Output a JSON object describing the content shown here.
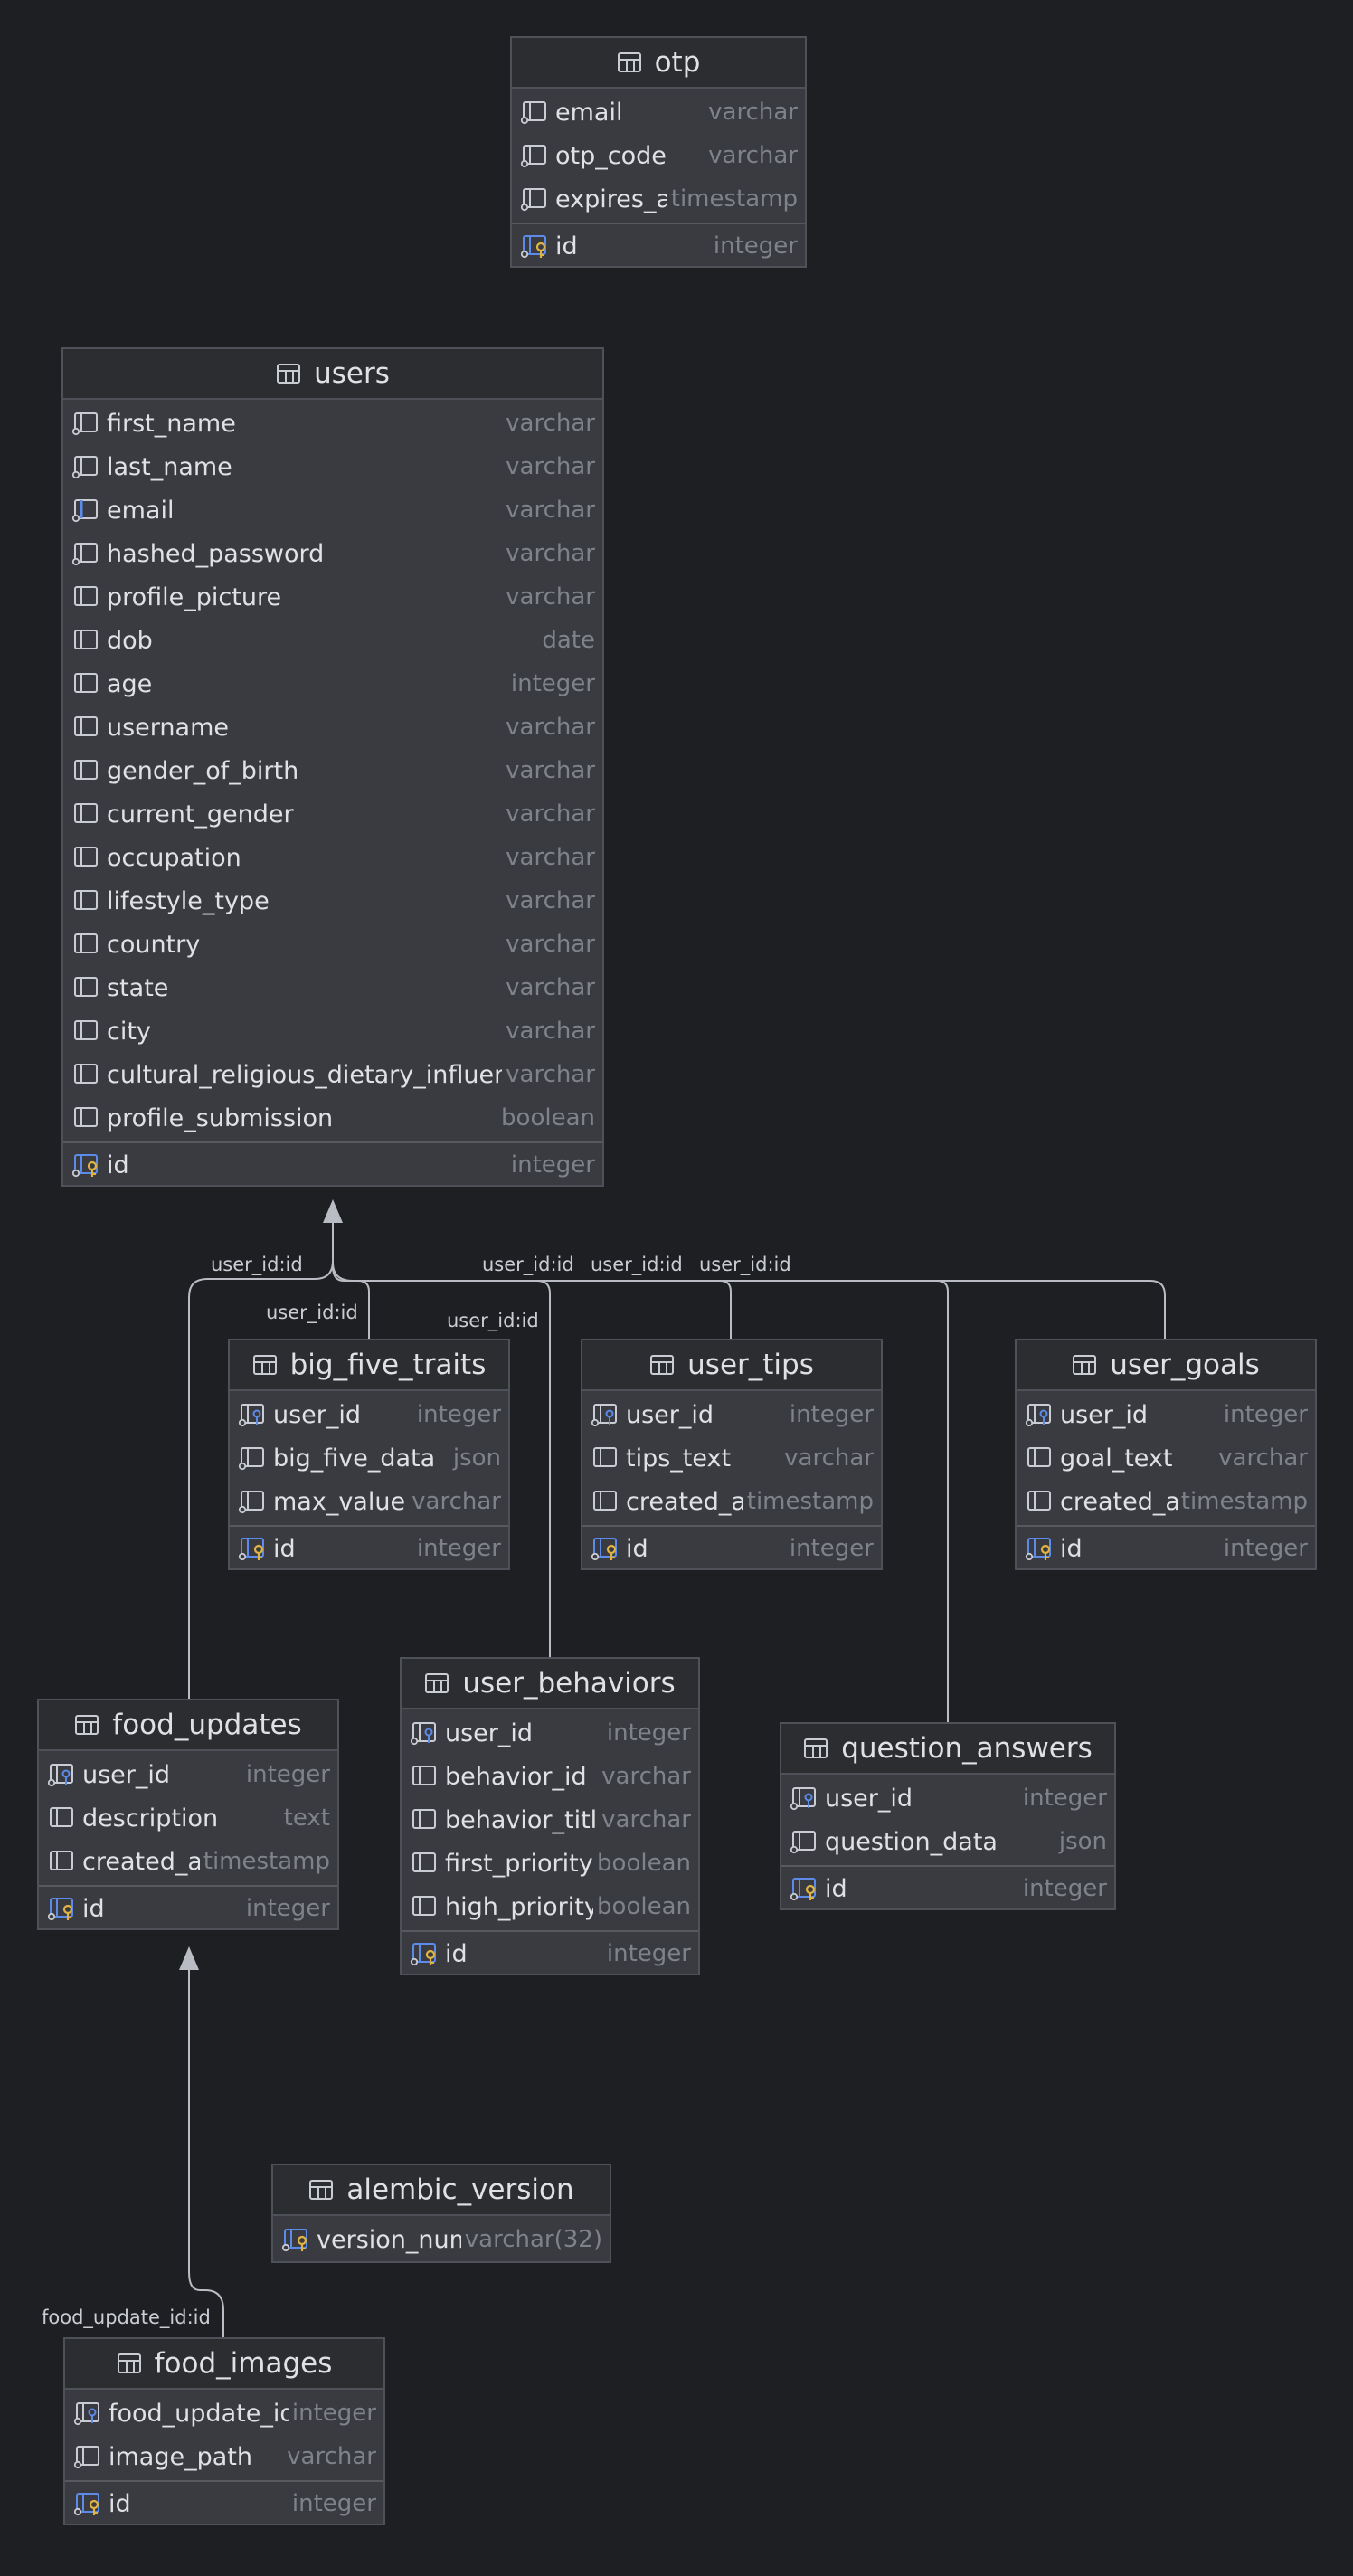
{
  "diagram_title": "",
  "colors": {
    "background": "#1e1f22",
    "table_body": "#393b40",
    "table_header": "#2b2d30",
    "border": "#4e5157",
    "type_text": "#7e8289",
    "key_gold": "#e1b341",
    "key_blue": "#5c8bea",
    "edge": "#b9bcc2"
  },
  "tables": {
    "otp": {
      "name": "otp",
      "columns": [
        {
          "name": "email",
          "type": "varchar",
          "icon": "column-icon"
        },
        {
          "name": "otp_code",
          "type": "varchar",
          "icon": "column-icon"
        },
        {
          "name": "expires_at",
          "type": "timestamp",
          "icon": "column-icon"
        }
      ],
      "pk": {
        "name": "id",
        "type": "integer",
        "icon": "primary-key-icon"
      }
    },
    "users": {
      "name": "users",
      "columns": [
        {
          "name": "first_name",
          "type": "varchar",
          "icon": "column-icon"
        },
        {
          "name": "last_name",
          "type": "varchar",
          "icon": "column-icon"
        },
        {
          "name": "email",
          "type": "varchar",
          "icon": "unique-column-icon"
        },
        {
          "name": "hashed_password",
          "type": "varchar",
          "icon": "column-icon"
        },
        {
          "name": "profile_picture",
          "type": "varchar",
          "icon": "nullable-column-icon"
        },
        {
          "name": "dob",
          "type": "date",
          "icon": "nullable-column-icon"
        },
        {
          "name": "age",
          "type": "integer",
          "icon": "nullable-column-icon"
        },
        {
          "name": "username",
          "type": "varchar",
          "icon": "nullable-column-icon"
        },
        {
          "name": "gender_of_birth",
          "type": "varchar",
          "icon": "nullable-column-icon"
        },
        {
          "name": "current_gender",
          "type": "varchar",
          "icon": "nullable-column-icon"
        },
        {
          "name": "occupation",
          "type": "varchar",
          "icon": "nullable-column-icon"
        },
        {
          "name": "lifestyle_type",
          "type": "varchar",
          "icon": "nullable-column-icon"
        },
        {
          "name": "country",
          "type": "varchar",
          "icon": "nullable-column-icon"
        },
        {
          "name": "state",
          "type": "varchar",
          "icon": "nullable-column-icon"
        },
        {
          "name": "city",
          "type": "varchar",
          "icon": "nullable-column-icon"
        },
        {
          "name": "cultural_religious_dietary_influences",
          "type": "varchar",
          "icon": "nullable-column-icon"
        },
        {
          "name": "profile_submission",
          "type": "boolean",
          "icon": "nullable-column-icon"
        }
      ],
      "pk": {
        "name": "id",
        "type": "integer",
        "icon": "primary-key-icon"
      }
    },
    "big_five_traits": {
      "name": "big_five_traits",
      "columns": [
        {
          "name": "user_id",
          "type": "integer",
          "icon": "foreign-key-icon"
        },
        {
          "name": "big_five_data",
          "type": "json",
          "icon": "column-icon"
        },
        {
          "name": "max_value",
          "type": "varchar",
          "icon": "column-icon"
        }
      ],
      "pk": {
        "name": "id",
        "type": "integer",
        "icon": "primary-key-icon"
      }
    },
    "user_tips": {
      "name": "user_tips",
      "columns": [
        {
          "name": "user_id",
          "type": "integer",
          "icon": "foreign-key-icon"
        },
        {
          "name": "tips_text",
          "type": "varchar",
          "icon": "nullable-column-icon"
        },
        {
          "name": "created_at",
          "type": "timestamp",
          "icon": "nullable-column-icon"
        }
      ],
      "pk": {
        "name": "id",
        "type": "integer",
        "icon": "primary-key-icon"
      }
    },
    "user_goals": {
      "name": "user_goals",
      "columns": [
        {
          "name": "user_id",
          "type": "integer",
          "icon": "foreign-key-icon"
        },
        {
          "name": "goal_text",
          "type": "varchar",
          "icon": "nullable-column-icon"
        },
        {
          "name": "created_at",
          "type": "timestamp",
          "icon": "nullable-column-icon"
        }
      ],
      "pk": {
        "name": "id",
        "type": "integer",
        "icon": "primary-key-icon"
      }
    },
    "user_behaviors": {
      "name": "user_behaviors",
      "columns": [
        {
          "name": "user_id",
          "type": "integer",
          "icon": "foreign-key-icon"
        },
        {
          "name": "behavior_id",
          "type": "varchar",
          "icon": "nullable-column-icon"
        },
        {
          "name": "behavior_title",
          "type": "varchar",
          "icon": "nullable-column-icon"
        },
        {
          "name": "first_priority",
          "type": "boolean",
          "icon": "nullable-column-icon"
        },
        {
          "name": "high_priority",
          "type": "boolean",
          "icon": "nullable-column-icon"
        }
      ],
      "pk": {
        "name": "id",
        "type": "integer",
        "icon": "primary-key-icon"
      }
    },
    "food_updates": {
      "name": "food_updates",
      "columns": [
        {
          "name": "user_id",
          "type": "integer",
          "icon": "foreign-key-icon"
        },
        {
          "name": "description",
          "type": "text",
          "icon": "nullable-column-icon"
        },
        {
          "name": "created_at",
          "type": "timestamp",
          "icon": "nullable-column-icon"
        }
      ],
      "pk": {
        "name": "id",
        "type": "integer",
        "icon": "primary-key-icon"
      }
    },
    "question_answers": {
      "name": "question_answers",
      "columns": [
        {
          "name": "user_id",
          "type": "integer",
          "icon": "foreign-key-icon"
        },
        {
          "name": "question_data",
          "type": "json",
          "icon": "column-icon"
        }
      ],
      "pk": {
        "name": "id",
        "type": "integer",
        "icon": "primary-key-icon"
      }
    },
    "alembic_version": {
      "name": "alembic_version",
      "columns": [],
      "pk": {
        "name": "version_num",
        "type": "varchar(32)",
        "icon": "primary-key-icon"
      }
    },
    "food_images": {
      "name": "food_images",
      "columns": [
        {
          "name": "food_update_id",
          "type": "integer",
          "icon": "foreign-key-icon"
        },
        {
          "name": "image_path",
          "type": "varchar",
          "icon": "column-icon"
        }
      ],
      "pk": {
        "name": "id",
        "type": "integer",
        "icon": "primary-key-icon"
      }
    }
  },
  "relationships": [
    {
      "from": "food_updates",
      "to": "users",
      "label": "user_id:id"
    },
    {
      "from": "big_five_traits",
      "to": "users",
      "label": "user_id:id"
    },
    {
      "from": "user_behaviors",
      "to": "users",
      "label": "user_id:id"
    },
    {
      "from": "question_answers",
      "to": "users",
      "label": "user_id:id"
    },
    {
      "from": "user_tips",
      "to": "users",
      "label": "user_id:id"
    },
    {
      "from": "user_goals",
      "to": "users",
      "label": "user_id:id"
    },
    {
      "from": "food_images",
      "to": "food_updates",
      "label": "food_update_id:id"
    }
  ]
}
